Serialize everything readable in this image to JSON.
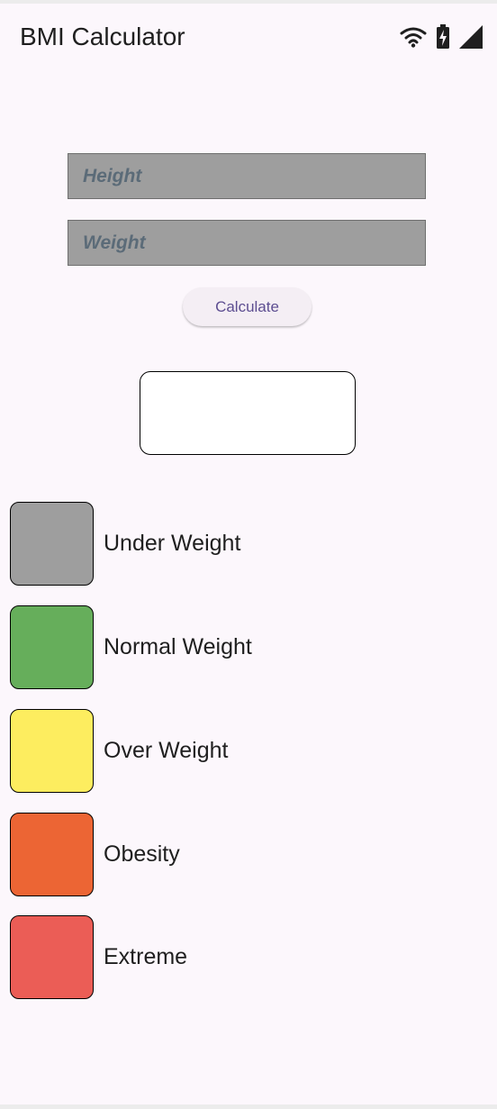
{
  "app_bar": {
    "title": "BMI Calculator",
    "status_icons": [
      "wifi-icon",
      "battery-charging-icon",
      "signal-icon"
    ]
  },
  "form": {
    "height_placeholder": "Height",
    "height_value": "",
    "weight_placeholder": "Weight",
    "weight_value": "",
    "calculate_label": "Calculate"
  },
  "result": {
    "value": ""
  },
  "legend": [
    {
      "label": "Under Weight",
      "color": "#9e9e9e"
    },
    {
      "label": "Normal Weight",
      "color": "#66ae5b"
    },
    {
      "label": "Over Weight",
      "color": "#fded5f"
    },
    {
      "label": "Obesity",
      "color": "#ec6534"
    },
    {
      "label": "Extreme",
      "color": "#eb5d56"
    }
  ]
}
